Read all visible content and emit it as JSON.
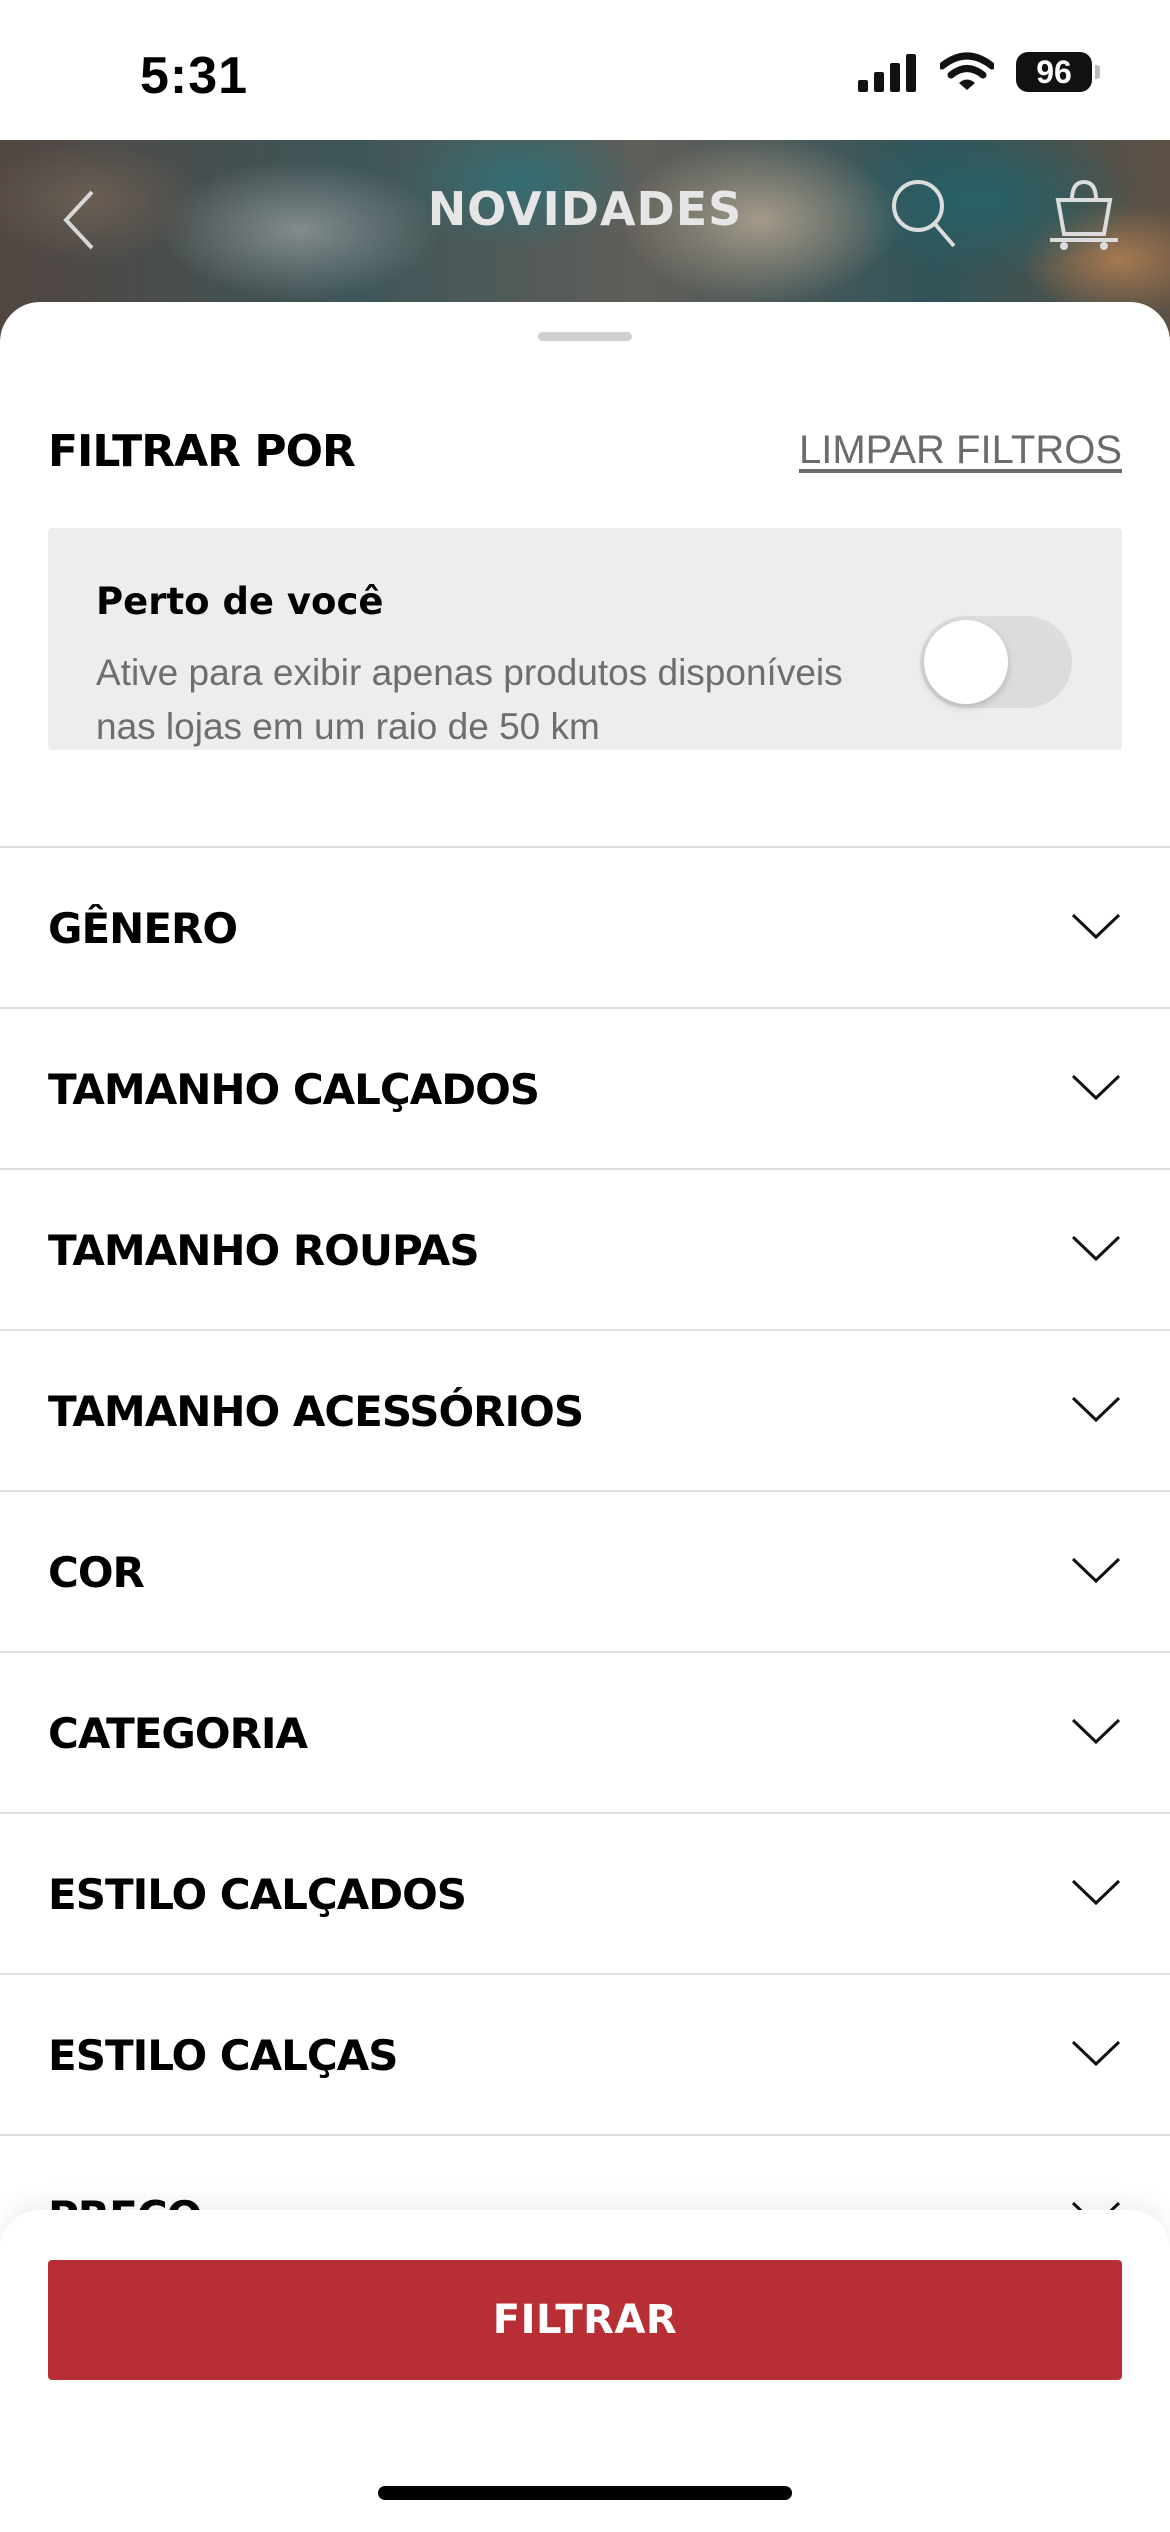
{
  "status_bar": {
    "time": "5:31",
    "battery": "96"
  },
  "header": {
    "title": "NOVIDADES"
  },
  "filters": {
    "title": "FILTRAR POR",
    "clear_label": "LIMPAR FILTROS",
    "near_you": {
      "title": "Perto de você",
      "description": "Ative para exibir apenas produtos disponíveis nas lojas em um raio de 50 km",
      "enabled": false
    },
    "items": [
      {
        "label": "GÊNERO"
      },
      {
        "label": "TAMANHO CALÇADOS"
      },
      {
        "label": "TAMANHO ROUPAS"
      },
      {
        "label": "TAMANHO ACESSÓRIOS"
      },
      {
        "label": "COR"
      },
      {
        "label": "CATEGORIA"
      },
      {
        "label": "ESTILO CALÇADOS"
      },
      {
        "label": "ESTILO CALÇAS"
      },
      {
        "label": "PREÇO"
      }
    ]
  },
  "actions": {
    "filter_button": "FILTRAR"
  },
  "colors": {
    "primary": "#b82e35",
    "panel": "#ededee",
    "muted_text": "#6e6e6e"
  }
}
